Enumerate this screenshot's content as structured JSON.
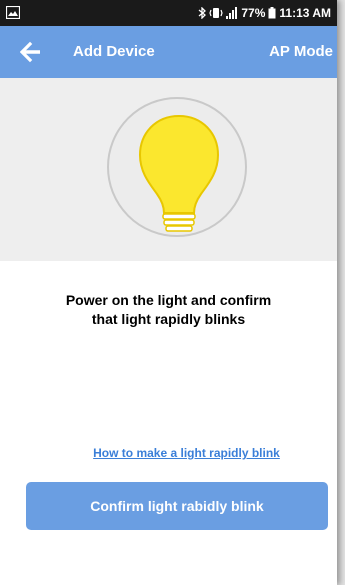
{
  "status_bar": {
    "battery": "77%",
    "time": "11:13 AM"
  },
  "app_bar": {
    "title": "Add Device",
    "mode": "AP Mode"
  },
  "hero": {
    "icon": "light-bulb-icon",
    "bulb_color": "#fbe72e"
  },
  "instruction": {
    "line1": "Power on the light and confirm",
    "line2": "that light rapidly blinks"
  },
  "help_link": "How to make a light rapidly blink",
  "confirm_button": "Confirm light rabidly blink",
  "colors": {
    "accent": "#6a9ee2",
    "link": "#3b7fd8"
  }
}
